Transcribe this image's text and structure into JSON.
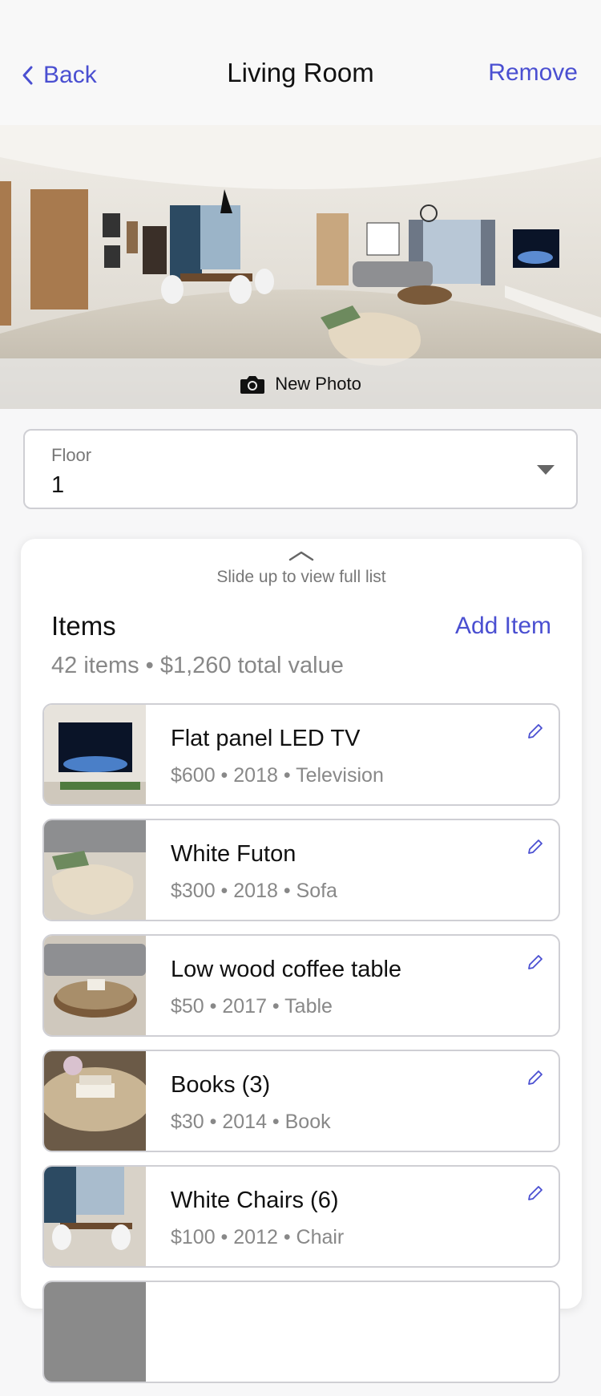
{
  "nav": {
    "back_label": "Back",
    "title": "Living Room",
    "remove_label": "Remove"
  },
  "photo": {
    "new_photo_label": "New Photo"
  },
  "floor": {
    "label": "Floor",
    "value": "1"
  },
  "items_panel": {
    "hint": "Slide up to view full list",
    "title": "Items",
    "add_label": "Add Item",
    "summary": "42 items • $1,260 total value"
  },
  "items": [
    {
      "name": "Flat panel LED TV",
      "meta": "$600 • 2018 • Television"
    },
    {
      "name": "White Futon",
      "meta": "$300 • 2018 • Sofa"
    },
    {
      "name": "Low wood coffee table",
      "meta": "$50 • 2017 • Table"
    },
    {
      "name": "Books (3)",
      "meta": "$30 • 2014 • Book"
    },
    {
      "name": "White Chairs (6)",
      "meta": "$100 • 2012 • Chair"
    }
  ],
  "colors": {
    "accent": "#4a4fd1",
    "muted_text": "#888888",
    "border": "#cfcfd4"
  },
  "icons": [
    "chevron-left-icon",
    "camera-icon",
    "caret-down-icon",
    "chevron-up-icon",
    "pencil-icon"
  ]
}
